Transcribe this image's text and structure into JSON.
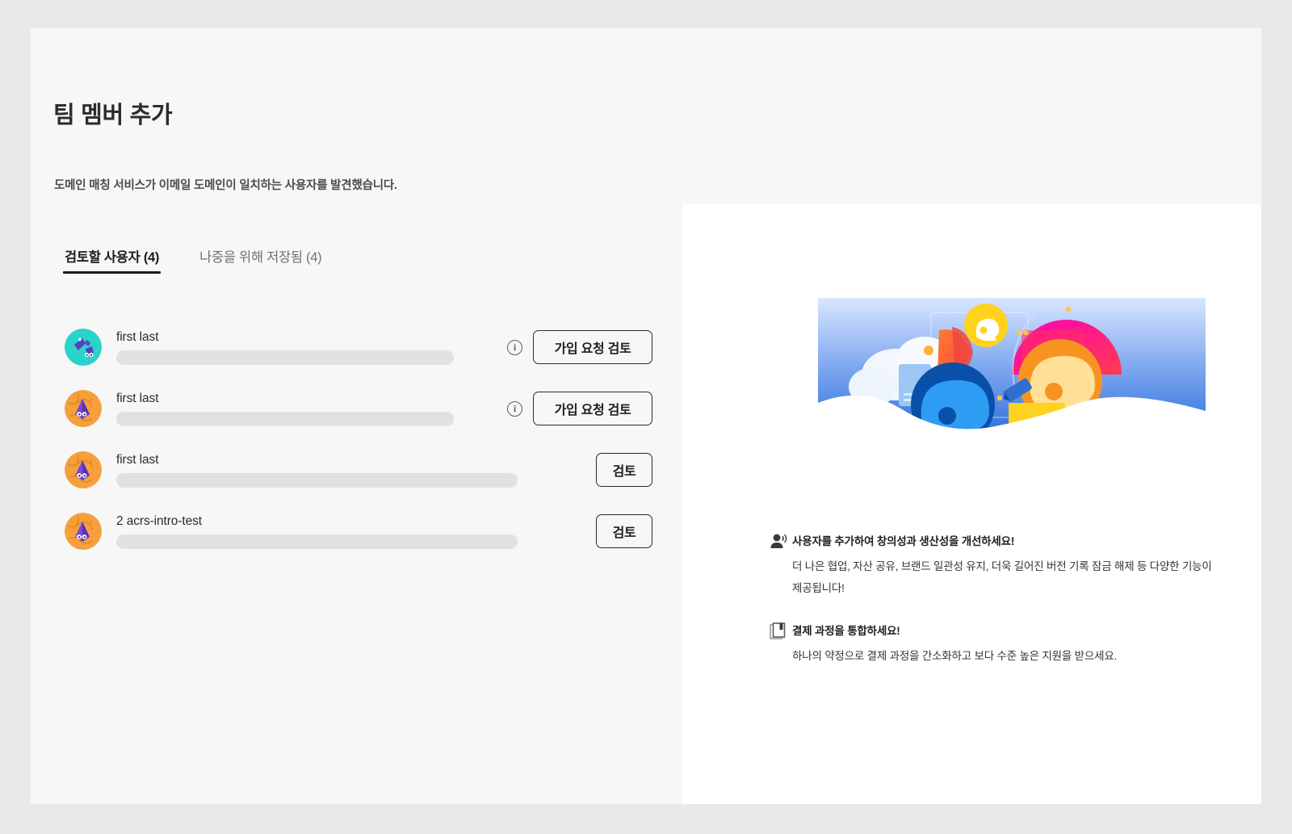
{
  "header": {
    "title": "팀 멤버 추가",
    "subtitle": "도메인 매칭 서비스가 이메일 도메인이 일치하는 사용자를 발견했습니다."
  },
  "tabs": [
    {
      "label": "검토할 사용자 (4)",
      "active": true
    },
    {
      "label": "나중을 위해 저장됨 (4)",
      "active": false
    }
  ],
  "users": [
    {
      "name": "first last",
      "email_redacted": true,
      "info_icon": "info-circle-icon",
      "action_label": "가입 요청 검토",
      "avatar_bg": "#2ad2c9",
      "avatar_fg": "#5b3cc4"
    },
    {
      "name": "first last",
      "email_redacted": true,
      "info_icon": "info-circle-icon",
      "action_label": "가입 요청 검토",
      "avatar_bg": "#f6a03c",
      "avatar_fg": "#6a3cc4"
    },
    {
      "name": "first last",
      "email_redacted": true,
      "info_icon": null,
      "action_label": "검토",
      "avatar_bg": "#f6a03c",
      "avatar_fg": "#6a3cc4"
    },
    {
      "name": "2 acrs-intro-test",
      "email_redacted": true,
      "info_icon": null,
      "action_label": "검토",
      "avatar_bg": "#f6a03c",
      "avatar_fg": "#6a3cc4"
    }
  ],
  "promo": {
    "illustration_name": "team-collaboration-illustration",
    "benefits": [
      {
        "icon": "user-add-icon",
        "title": "사용자를 추가하여 창의성과 생산성을 개선하세요!",
        "desc": "더 나은 협업, 자산 공유, 브랜드 일관성 유지, 더욱 길어진 버전 기록 잠금 해제 등 다양한 기능이 제공됩니다!"
      },
      {
        "icon": "billing-document-icon",
        "title": "결제 과정을 통합하세요!",
        "desc": "하나의 약정으로 결제 과정을 간소화하고 보다 수준 높은 지원을 받으세요."
      }
    ]
  },
  "colors": {
    "page_bg": "#e9e9e9",
    "card_bg": "#f7f7f8",
    "panel_bg": "#ffffff",
    "text_primary": "#1f1f1f",
    "text_secondary": "#707070",
    "redaction": "#e1e1e1",
    "tab_underline": "#1a1a1a"
  }
}
